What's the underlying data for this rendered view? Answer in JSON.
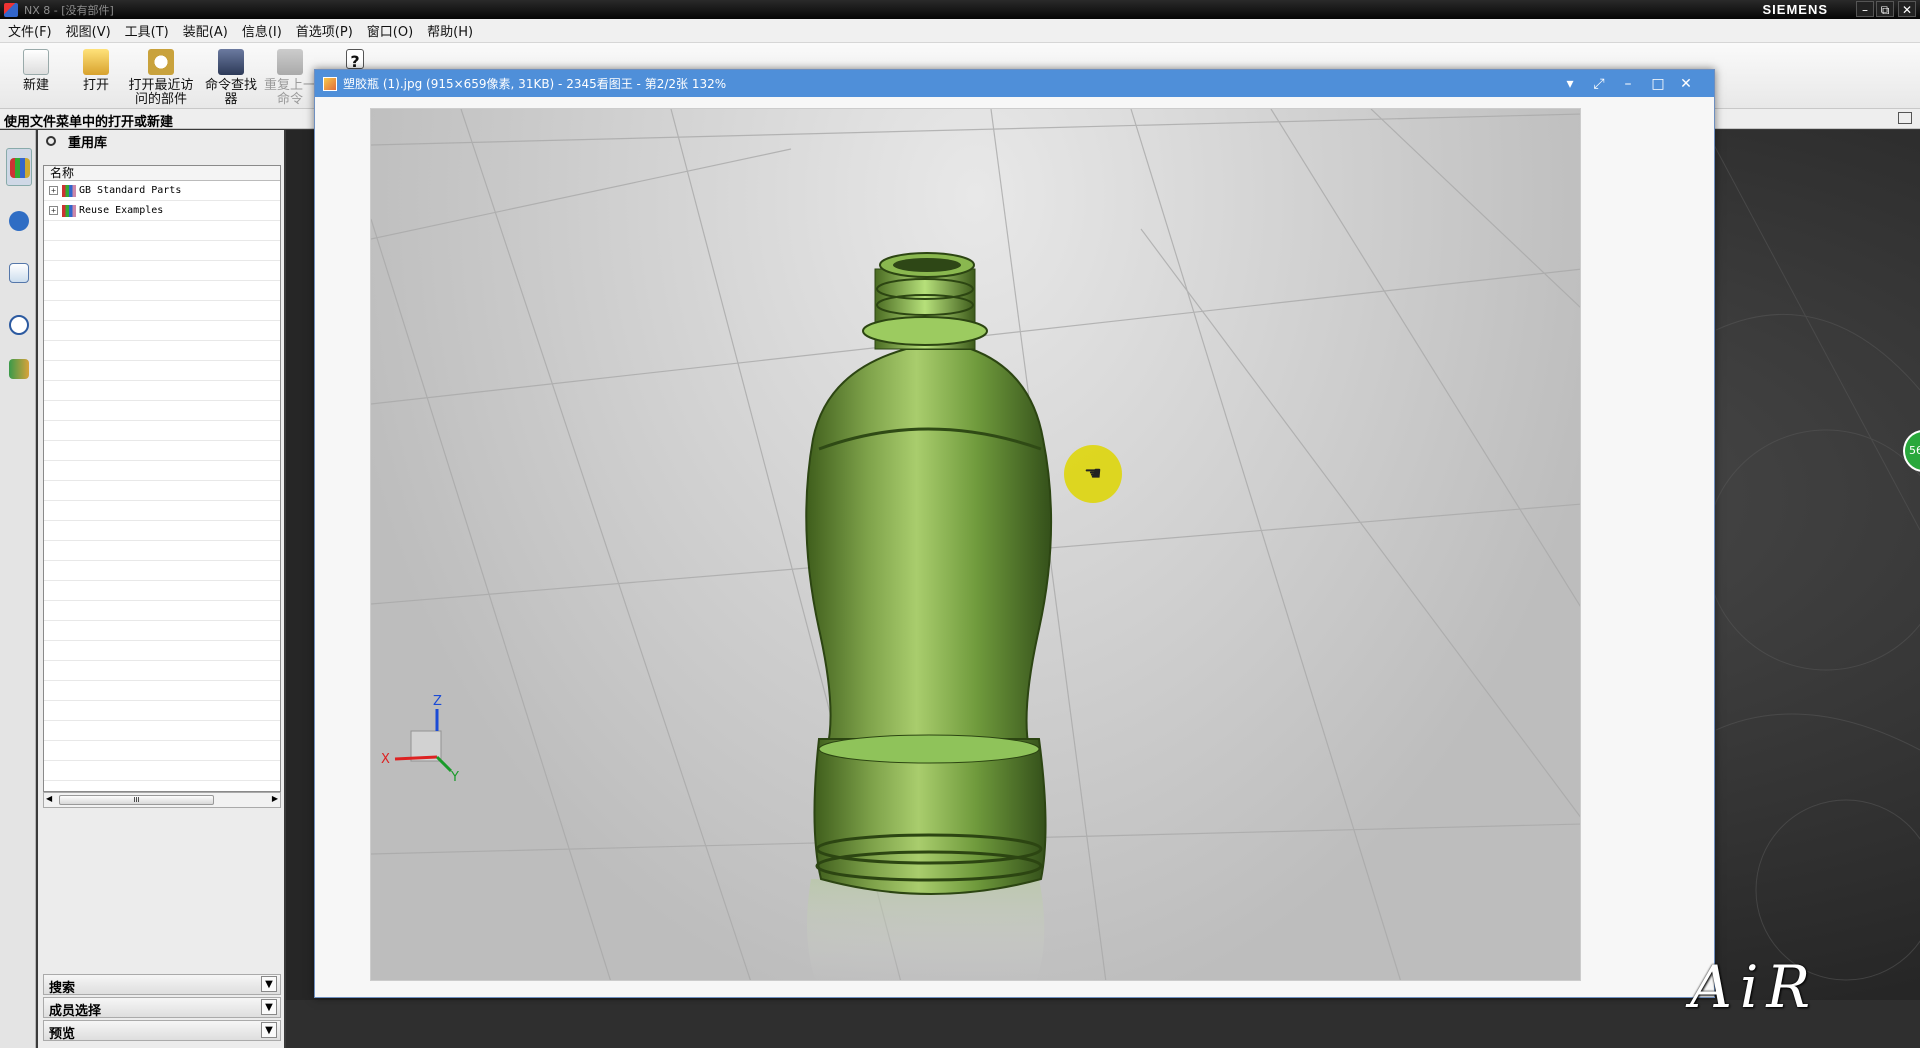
{
  "app": {
    "title": "NX 8 - [没有部件]",
    "brand": "SIEMENS",
    "window_controls": [
      "–",
      "⧉",
      "✕"
    ]
  },
  "menubar": {
    "items": [
      "文件(F)",
      "视图(V)",
      "工具(T)",
      "装配(A)",
      "信息(I)",
      "首选项(P)",
      "窗口(O)",
      "帮助(H)"
    ]
  },
  "toolbar": {
    "new": "新建",
    "open": "打开",
    "recent_line1": "打开最近访",
    "recent_line2": "问的部件",
    "finder_line1": "命令查找",
    "finder_line2": "器",
    "repeat_line1": "重复上一",
    "repeat_line2": "命令",
    "help": "?"
  },
  "hint": "使用文件菜单中的打开或新建",
  "resource_bar": {
    "icons": [
      "reuse-library-icon",
      "hd3d-tools-icon",
      "web-browser-icon",
      "history-icon",
      "roles-icon"
    ]
  },
  "reuse_panel": {
    "title": "重用库",
    "column_header": "名称",
    "items": [
      "GB Standard Parts",
      "Reuse Examples"
    ],
    "scroll_mark": "III",
    "sections": [
      "搜索",
      "成员选择",
      "预览"
    ]
  },
  "viewer": {
    "title": "塑胶瓶 (1).jpg (915×659像素, 31KB) - 2345看图王 - 第2/2张 132%",
    "controls": [
      "▾",
      "⤢",
      "–",
      "□",
      "✕"
    ]
  },
  "triad": {
    "z": "Z",
    "x": "X",
    "y": "Y"
  },
  "side_badge": "56",
  "watermark": "AiR",
  "colors": {
    "viewer_bar": "#4f8fd9",
    "bottle_green": "#6f9a3c",
    "cursor_highlight": "#ded600"
  }
}
